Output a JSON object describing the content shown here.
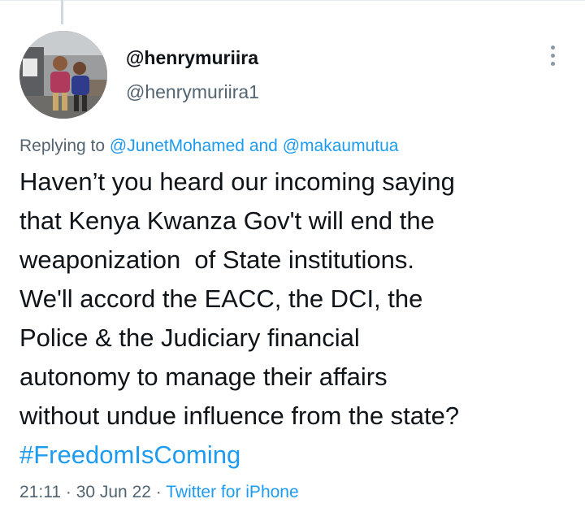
{
  "tweet": {
    "author": {
      "display_name": "@henrymuriira",
      "handle": "@henrymuriira1"
    },
    "reply": {
      "prefix": "Replying to",
      "mention_1": "@JunetMohamed",
      "joiner": "and",
      "mention_2": "@makaumutua"
    },
    "text_lines": [
      "Haven’t you heard our incoming saying",
      "that Kenya Kwanza Gov't will end the",
      "weaponization  of State institutions.",
      "We'll accord the EACC, the DCI, the",
      "Police & the Judiciary financial",
      "autonomy to manage their affairs",
      "without undue influence from the state?"
    ],
    "hashtag": "#FreedomIsComing",
    "meta": {
      "time": "21:11",
      "separator": "·",
      "date": "30 Jun 22",
      "source": "Twitter for iPhone"
    }
  },
  "icons": {
    "more": "more-dots-icon"
  },
  "colors": {
    "link": "#1d9bf0",
    "secondary_text": "#536471",
    "primary_text": "#0f1419"
  }
}
